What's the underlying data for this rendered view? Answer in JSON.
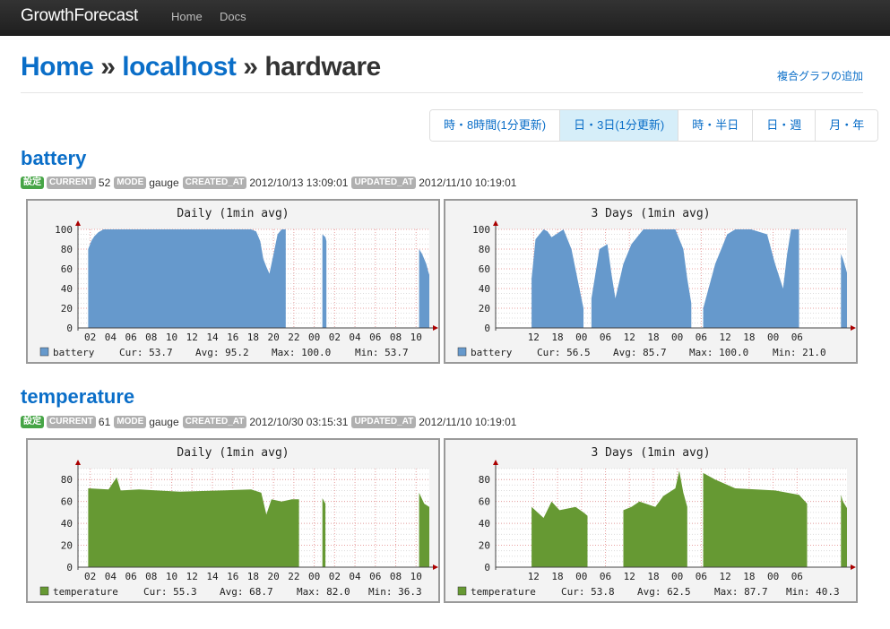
{
  "nav": {
    "brand": "GrowthForecast",
    "links": [
      "Home",
      "Docs"
    ]
  },
  "breadcrumb": {
    "home": "Home",
    "sep": "»",
    "service": "localhost",
    "section": "hardware"
  },
  "add_complex_link": "複合グラフの追加",
  "range_buttons": [
    {
      "label": "時・8時間(1分更新)",
      "active": false
    },
    {
      "label": "日・3日(1分更新)",
      "active": true
    },
    {
      "label": "時・半日",
      "active": false
    },
    {
      "label": "日・週",
      "active": false
    },
    {
      "label": "月・年",
      "active": false
    }
  ],
  "sections": [
    {
      "title": "battery",
      "badges": {
        "settings": "設定",
        "current": "CURRENT",
        "mode": "MODE",
        "created": "CREATED_AT",
        "updated": "UPDATED_AT"
      },
      "current": "52",
      "mode": "gauge",
      "created_at": "2012/10/13 13:09:01",
      "updated_at": "2012/11/10 10:19:01",
      "graphs": [
        {
          "title": "Daily (1min avg)",
          "legend_name": "battery",
          "cur": "Cur: 53.7",
          "avg": "Avg: 95.2",
          "max": "Max: 100.0",
          "min": "Min: 53.7"
        },
        {
          "title": "3 Days (1min avg)",
          "legend_name": "battery",
          "cur": "Cur: 56.5",
          "avg": "Avg: 85.7",
          "max": "Max: 100.0",
          "min": "Min: 21.0"
        }
      ]
    },
    {
      "title": "temperature",
      "badges": {
        "settings": "設定",
        "current": "CURRENT",
        "mode": "MODE",
        "created": "CREATED_AT",
        "updated": "UPDATED_AT"
      },
      "current": "61",
      "mode": "gauge",
      "created_at": "2012/10/30 03:15:31",
      "updated_at": "2012/11/10 10:19:01",
      "graphs": [
        {
          "title": "Daily (1min avg)",
          "legend_name": "temperature",
          "cur": "Cur: 55.3",
          "avg": "Avg: 68.7",
          "max": "Max: 82.0",
          "min": "Min: 36.3"
        },
        {
          "title": "3 Days (1min avg)",
          "legend_name": "temperature",
          "cur": "Cur: 53.8",
          "avg": "Avg: 62.5",
          "max": "Max: 87.7",
          "min": "Min: 40.3"
        }
      ]
    }
  ],
  "chart_data": [
    {
      "type": "area",
      "title": "Daily (1min avg)",
      "series": [
        {
          "name": "battery",
          "color": "#6699cc"
        }
      ],
      "ylim": [
        0,
        100
      ],
      "yticks": [
        "0",
        "20",
        "40",
        "60",
        "80",
        "100"
      ],
      "xticks": [
        "02",
        "04",
        "06",
        "08",
        "10",
        "12",
        "14",
        "16",
        "18",
        "20",
        "22",
        "00",
        "02",
        "04",
        "06",
        "08",
        "10"
      ],
      "x_extent": [
        1,
        10.4
      ],
      "x": [
        1,
        1.3,
        1.6,
        2,
        2.5,
        3,
        17,
        17.5,
        17.9,
        18.2,
        18.5,
        18.8,
        19.2,
        19.6,
        20,
        20.4,
        20.5,
        21,
        21.4,
        21.7,
        23.9,
        24,
        24.3,
        24.4,
        24.5,
        33.4,
        33.5,
        33.8,
        34.2,
        34.4,
        34.5
      ],
      "values": [
        80,
        88,
        93,
        97,
        100,
        100,
        100,
        98,
        88,
        70,
        62,
        55,
        75,
        95,
        100,
        100,
        null,
        null,
        null,
        null,
        null,
        95,
        92,
        88,
        null,
        null,
        80,
        75,
        65,
        57,
        54
      ],
      "legend": "bottom"
    },
    {
      "type": "area",
      "title": "3 Days (1min avg)",
      "series": [
        {
          "name": "battery",
          "color": "#6699cc"
        }
      ],
      "ylim": [
        0,
        100
      ],
      "yticks": [
        "0",
        "20",
        "40",
        "60",
        "80",
        "100"
      ],
      "xticks": [
        "12",
        "18",
        "00",
        "06",
        "12",
        "18",
        "00",
        "06",
        "12",
        "18",
        "00",
        "06"
      ],
      "x_extent": [
        9,
        10.4
      ],
      "x": [
        9,
        10,
        12,
        13,
        14,
        17,
        19,
        21,
        22,
        22.5,
        23,
        24,
        26,
        28,
        29,
        30,
        32,
        34,
        37,
        38,
        40,
        42,
        45,
        47,
        48,
        49,
        51,
        52,
        55,
        58,
        60,
        64,
        68,
        70,
        72,
        73,
        74,
        75,
        76,
        79,
        81,
        82,
        83,
        86,
        86.5,
        87,
        88
      ],
      "values": [
        50,
        90,
        100,
        98,
        92,
        100,
        80,
        40,
        20,
        null,
        null,
        30,
        80,
        85,
        55,
        30,
        65,
        85,
        100,
        100,
        100,
        100,
        100,
        80,
        50,
        25,
        null,
        20,
        65,
        95,
        100,
        100,
        95,
        65,
        40,
        75,
        100,
        100,
        100,
        null,
        null,
        null,
        null,
        null,
        75,
        70,
        56
      ],
      "legend": "bottom"
    },
    {
      "type": "area",
      "title": "Daily (1min avg)",
      "series": [
        {
          "name": "temperature",
          "color": "#669933"
        }
      ],
      "ylim": [
        0,
        90
      ],
      "yticks": [
        "0",
        "20",
        "40",
        "60",
        "80"
      ],
      "xticks": [
        "02",
        "04",
        "06",
        "08",
        "10",
        "12",
        "14",
        "16",
        "18",
        "20",
        "22",
        "00",
        "02",
        "04",
        "06",
        "08",
        "10"
      ],
      "x_extent": [
        1,
        10.4
      ],
      "x": [
        1,
        3,
        3.8,
        4.2,
        6,
        10,
        14,
        17,
        18,
        18.5,
        19,
        20,
        21,
        21.7,
        23.9,
        24,
        24.3,
        24.5,
        33.4,
        33.5,
        34,
        34.5
      ],
      "values": [
        72,
        71,
        82,
        70,
        71,
        69,
        70,
        71,
        68,
        48,
        62,
        60,
        62,
        62,
        null,
        63,
        58,
        null,
        null,
        68,
        58,
        55
      ],
      "legend": "bottom"
    },
    {
      "type": "area",
      "title": "3 Days (1min avg)",
      "series": [
        {
          "name": "temperature",
          "color": "#669933"
        }
      ],
      "ylim": [
        0,
        90
      ],
      "yticks": [
        "0",
        "20",
        "40",
        "60",
        "80"
      ],
      "xticks": [
        "12",
        "18",
        "00",
        "06",
        "12",
        "18",
        "00",
        "06",
        "12",
        "18",
        "00",
        "06"
      ],
      "x_extent": [
        9,
        10.4
      ],
      "x": [
        9,
        12,
        14,
        16,
        20,
        22,
        23,
        26,
        30,
        32,
        34,
        36,
        40,
        42,
        45,
        46,
        47,
        48,
        49,
        51,
        52,
        55,
        60,
        70,
        76,
        78,
        79,
        81,
        82,
        83,
        86,
        86.5,
        87,
        88
      ],
      "values": [
        55,
        45,
        60,
        52,
        55,
        50,
        47,
        null,
        null,
        52,
        55,
        60,
        55,
        65,
        72,
        88,
        68,
        55,
        null,
        null,
        86,
        80,
        72,
        70,
        66,
        58,
        null,
        null,
        58,
        null,
        null,
        66,
        60,
        54
      ],
      "legend": "bottom"
    }
  ]
}
